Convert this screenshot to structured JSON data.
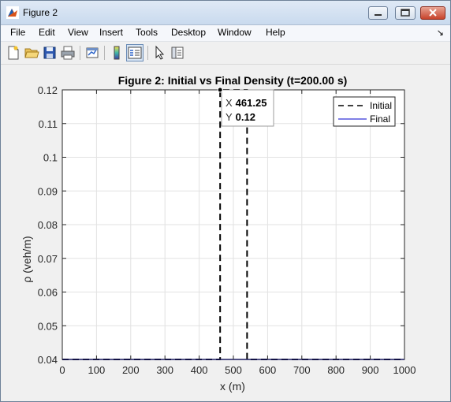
{
  "window": {
    "title": "Figure 2",
    "menu": [
      "File",
      "Edit",
      "View",
      "Insert",
      "Tools",
      "Desktop",
      "Window",
      "Help"
    ],
    "dock_arrow": "↘"
  },
  "toolbar": {
    "buttons": [
      "new-figure",
      "open-file",
      "save",
      "print",
      "link-plot",
      "insert-colorbar",
      "insert-legend",
      "edit-plot",
      "open-property-inspector"
    ]
  },
  "colors": {
    "initial_line": "#000000",
    "final_line": "#0000cc",
    "grid": "#e2e2e2",
    "title_bar": "#c9daee"
  },
  "datatip": {
    "x_label": "X",
    "x_value": "461.25",
    "y_label": "Y",
    "y_value": "0.12"
  },
  "chart_data": {
    "type": "line",
    "title": "Figure 2: Initial vs Final Density (t=200.00 s)",
    "xlabel": "x (m)",
    "ylabel": "ρ (veh/m)",
    "xlim": [
      0,
      1000
    ],
    "ylim": [
      0.04,
      0.12
    ],
    "xticks": [
      "0",
      "100",
      "200",
      "300",
      "400",
      "500",
      "600",
      "700",
      "800",
      "900",
      "1000"
    ],
    "yticks": [
      "0.04",
      "0.05",
      "0.06",
      "0.07",
      "0.08",
      "0.09",
      "0.1",
      "0.11",
      "0.12"
    ],
    "grid": true,
    "legend_position": "top-right",
    "series": [
      {
        "name": "Initial",
        "style": "dashed",
        "x": [
          0,
          461.25,
          461.25,
          540,
          540,
          1000
        ],
        "y": [
          0.04,
          0.04,
          0.12,
          0.12,
          0.04,
          0.04
        ]
      },
      {
        "name": "Final",
        "style": "solid",
        "x": [
          0,
          1000
        ],
        "y": [
          0.04,
          0.04
        ]
      }
    ]
  }
}
